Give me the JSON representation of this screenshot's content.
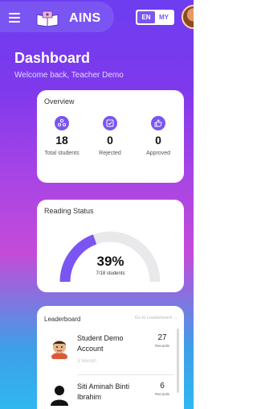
{
  "header": {
    "app_name": "AINS",
    "lang_options": [
      "EN",
      "MY"
    ],
    "active_lang": "EN"
  },
  "page": {
    "title": "Dashboard",
    "welcome": "Welcome back, Teacher Demo"
  },
  "overview": {
    "title": "Overview",
    "stats": [
      {
        "value": "18",
        "label": "Total students",
        "icon": "group-icon"
      },
      {
        "value": "0",
        "label": "Rejected",
        "icon": "rejected-icon"
      },
      {
        "value": "0",
        "label": "Approved",
        "icon": "thumbs-up-icon"
      }
    ]
  },
  "reading": {
    "title": "Reading Status",
    "percent_text": "39%",
    "progress": 0.39,
    "sub": "7/18 students"
  },
  "leaderboard": {
    "title": "Leaderboard",
    "link": "Go to Leaderboard →",
    "rows": [
      {
        "name": "Student Demo Account",
        "meta": "3 Merah",
        "count": "27",
        "count_label": "Records"
      },
      {
        "name": "Siti Aminah Binti Ibrahim",
        "meta": "",
        "count": "6",
        "count_label": "Records"
      }
    ]
  },
  "colors": {
    "accent": "#7b55f2",
    "gauge_track": "#e9e9ec"
  }
}
